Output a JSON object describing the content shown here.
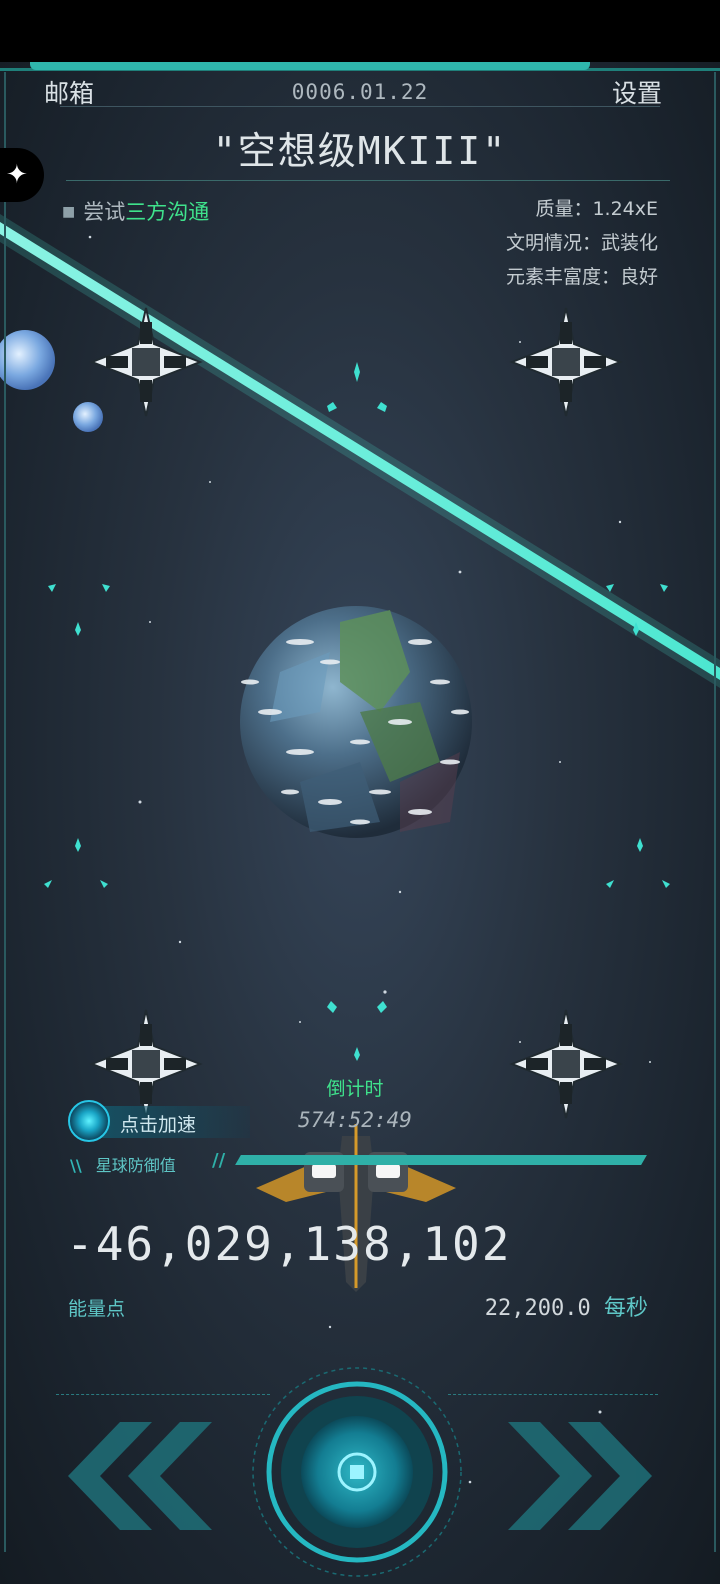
{
  "header": {
    "mailbox_label": "邮箱",
    "date": "0006.01.22",
    "settings_label": "设置",
    "planet_name": "\"空想级MKIII\""
  },
  "task": {
    "prefix": "尝试",
    "highlight": "三方沟通"
  },
  "stats": {
    "mass": "质量：1.24xE",
    "civilization": "文明情况：武装化",
    "elements": "元素丰富度：良好"
  },
  "countdown": {
    "label": "倒计时",
    "value": "574:52:49"
  },
  "speedup_label": "点击加速",
  "defense": {
    "label": "星球防御值",
    "level": 1.0
  },
  "energy": {
    "value": "-46,029,138,102",
    "label": "能量点",
    "rate": "22,200.0",
    "rate_unit": "每秒"
  },
  "colors": {
    "accent": "#2fb6ac",
    "highlight_green": "#3fe28c",
    "cyan_text": "#5ec6c6"
  },
  "icons": [
    "puzzle-icon",
    "speedup-icon",
    "left-arrow-icon",
    "center-button-icon",
    "right-arrow-icon"
  ]
}
